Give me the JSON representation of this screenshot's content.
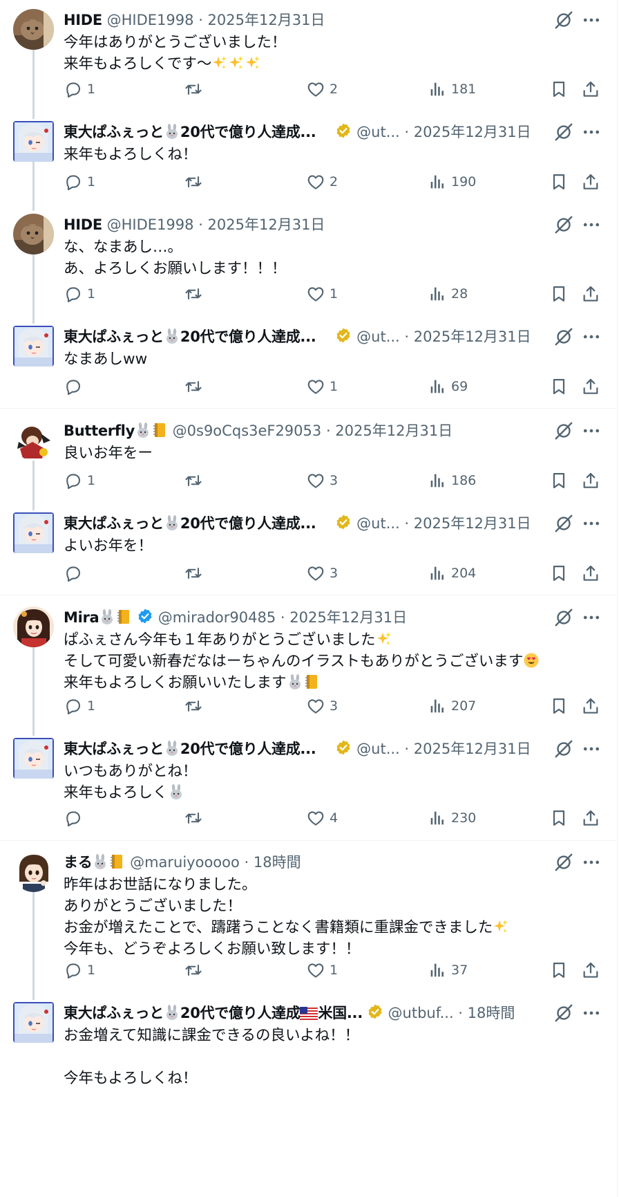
{
  "tweets": [
    {
      "name": "HIDE",
      "handle": "@HIDE1998",
      "time": "2025年12月31日",
      "lines": [
        "今年はありがとうございました！",
        "来年もよろしくです〜✨✨✨"
      ],
      "reply": "1",
      "retweet": "",
      "like": "2",
      "views": "181"
    },
    {
      "name": "東大ぱふぇっと🐰20代で億り人達成...",
      "handle": "@ut...",
      "time": "2025年12月31日",
      "lines": [
        "来年もよろしくね！"
      ],
      "reply": "1",
      "retweet": "",
      "like": "2",
      "views": "190"
    },
    {
      "name": "HIDE",
      "handle": "@HIDE1998",
      "time": "2025年12月31日",
      "lines": [
        "な、なまあし…。",
        "あ、よろしくお願いします！！！"
      ],
      "reply": "1",
      "retweet": "",
      "like": "1",
      "views": "28"
    },
    {
      "name": "東大ぱふぇっと🐰20代で億り人達成...",
      "handle": "@ut...",
      "time": "2025年12月31日",
      "lines": [
        "なまあしww"
      ],
      "reply": "",
      "retweet": "",
      "like": "1",
      "views": "69"
    },
    {
      "name": "Butterfly🐰📒",
      "handle": "@0s9oCqs3eF29053",
      "time": "2025年12月31日",
      "lines": [
        "良いお年をー"
      ],
      "reply": "1",
      "retweet": "",
      "like": "3",
      "views": "186"
    },
    {
      "name": "東大ぱふぇっと🐰20代で億り人達成...",
      "handle": "@ut...",
      "time": "2025年12月31日",
      "lines": [
        "よいお年を！"
      ],
      "reply": "",
      "retweet": "",
      "like": "3",
      "views": "204"
    },
    {
      "name": "Mira🐰📒",
      "handle": "@mirador90485",
      "time": "2025年12月31日",
      "lines": [
        "ぱふぇさん今年も１年ありがとうございました✨",
        "そして可愛い新春だなはーちゃんのイラストもありがとうございます😍",
        "来年もよろしくお願いいたします🐰📒"
      ],
      "reply": "1",
      "retweet": "",
      "like": "3",
      "views": "207"
    },
    {
      "name": "東大ぱふぇっと🐰20代で億り人達成...",
      "handle": "@ut...",
      "time": "2025年12月31日",
      "lines": [
        "いつもありがとね！",
        "来年もよろしく🐰"
      ],
      "reply": "",
      "retweet": "",
      "like": "4",
      "views": "230"
    },
    {
      "name": "まる🐰📒",
      "handle": "@maruiyooooo",
      "time": "18時間",
      "lines": [
        "昨年はお世話になりました。",
        "ありがとうございました！",
        "お金が増えたことで、躊躇うことなく書籍類に重課金できました✨",
        "今年も、どうぞよろしくお願い致します！！"
      ],
      "reply": "1",
      "retweet": "",
      "like": "1",
      "views": "37"
    },
    {
      "name": "東大ぱふぇっと🐰20代で億り人達成🇺🇸米国...",
      "handle": "@utbuf...",
      "time": "18時間",
      "lines": [
        "お金増えて知識に課金できるの良いよね！！",
        "",
        "今年もよろしくね！"
      ],
      "reply": "",
      "retweet": "",
      "like": "",
      "views": ""
    }
  ],
  "icons": {
    "reply": "reply-icon",
    "retweet": "retweet-icon",
    "like": "heart-icon",
    "views": "views-icon",
    "bookmark": "bookmark-icon",
    "share": "share-icon",
    "grok": "grok-icon",
    "more": "more-icon"
  },
  "colors": {
    "text": "#0f1419",
    "secondary": "#536471",
    "verified_gold": "#e2b719",
    "verified_blue": "#1d9bf0",
    "thread_line": "#cfd9de",
    "border": "#eff3f4"
  }
}
